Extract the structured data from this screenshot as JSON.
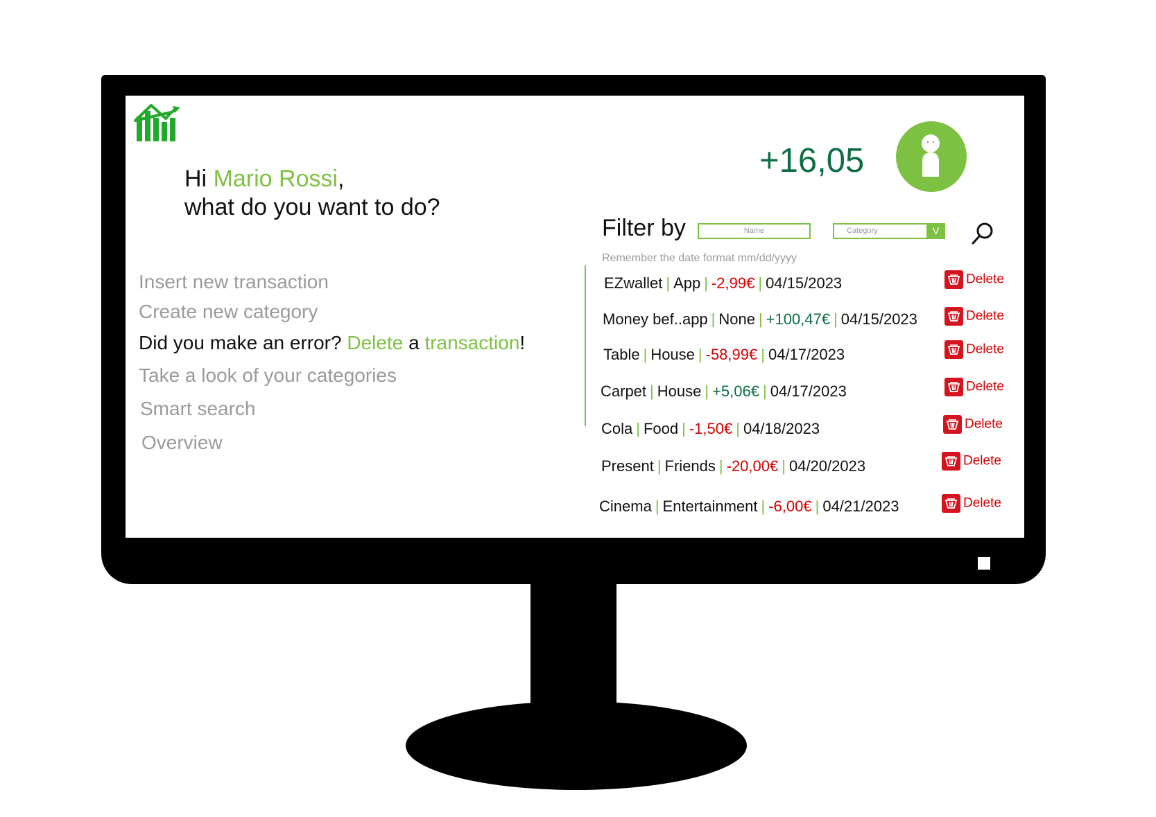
{
  "greeting": {
    "prefix": "Hi ",
    "user_name": "Mario Rossi",
    "comma": ",",
    "question": "what do you want to do?"
  },
  "balance": "+16,05",
  "menu": {
    "insert_transaction": "Insert new transaction",
    "create_category": "Create new category",
    "delete_prefix": "Did you make an error? ",
    "delete_word": "Delete",
    "delete_mid": " a ",
    "delete_transaction_word": "transaction",
    "delete_suffix": "!",
    "categories": "Take a look of your categories",
    "smart_search": "Smart search",
    "overview": "Overview"
  },
  "filter": {
    "label": "Filter by",
    "name_placeholder": "Name",
    "category_placeholder": "Category",
    "dropdown_glyph": "V",
    "hint": "Remember the date format mm/dd/yyyy"
  },
  "transactions": [
    {
      "name": "EZwallet",
      "category": "App",
      "amount": "-2,99€",
      "sign": "neg",
      "date": "04/15/2023",
      "delete_label": "Delete"
    },
    {
      "name": "Money bef..app",
      "category": "None",
      "amount": "+100,47€",
      "sign": "pos",
      "date": "04/15/2023",
      "delete_label": "Delete"
    },
    {
      "name": "Table",
      "category": "House",
      "amount": "-58,99€",
      "sign": "neg",
      "date": "04/17/2023",
      "delete_label": "Delete"
    },
    {
      "name": "Carpet",
      "category": "House",
      "amount": "+5,06€",
      "sign": "pos",
      "date": "04/17/2023",
      "delete_label": "Delete"
    },
    {
      "name": "Cola",
      "category": "Food",
      "amount": "-1,50€",
      "sign": "neg",
      "date": "04/18/2023",
      "delete_label": "Delete"
    },
    {
      "name": "Present",
      "category": "Friends",
      "amount": "-20,00€",
      "sign": "neg",
      "date": "04/20/2023",
      "delete_label": "Delete"
    },
    {
      "name": "Cinema",
      "category": "Entertainment",
      "amount": "-6,00€",
      "sign": "neg",
      "date": "04/21/2023",
      "delete_label": "Delete"
    }
  ],
  "colors": {
    "accent_green": "#7dc142",
    "balance_green": "#0d6e45",
    "negative_red": "#d40000",
    "delete_red": "#d4141e",
    "menu_gray": "#9a9a9a"
  },
  "icons": {
    "logo": "bar-chart-growth-icon",
    "avatar": "user-icon",
    "search": "search-icon",
    "delete": "trash-basket-icon"
  }
}
